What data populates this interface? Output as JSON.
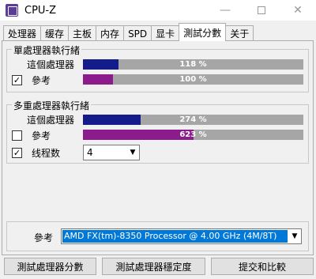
{
  "window": {
    "title": "CPU-Z",
    "minimize_glyph": "—",
    "close_glyph": "✕"
  },
  "tabs": [
    {
      "label": "处理器"
    },
    {
      "label": "缓存"
    },
    {
      "label": "主板"
    },
    {
      "label": "内存"
    },
    {
      "label": "SPD"
    },
    {
      "label": "显卡"
    },
    {
      "label": "測試分數"
    },
    {
      "label": "关于"
    }
  ],
  "single_thread": {
    "title": "單處理器執行緒",
    "this_cpu": {
      "label": "這個處理器",
      "value_text": "118 %",
      "fill_fraction": 0.16,
      "color": "#141c8c"
    },
    "reference": {
      "label": "參考",
      "checked": "✓",
      "value_text": "100 %",
      "fill_fraction": 0.135,
      "color": "#8c1c8c"
    }
  },
  "multi_thread": {
    "title": "多重處理器執行緒",
    "this_cpu": {
      "label": "這個處理器",
      "value_text": "274 %",
      "fill_fraction": 0.26,
      "color": "#141c8c"
    },
    "reference": {
      "label": "參考",
      "checked": "",
      "value_text": "623 %",
      "fill_fraction": 0.5,
      "color": "#8c1c8c"
    },
    "threads": {
      "label": "线程数",
      "checked": "✓",
      "value": "4"
    }
  },
  "reference_select": {
    "label": "參考",
    "value": "AMD FX(tm)-8350 Processor @ 4.00 GHz (4M/8T)"
  },
  "buttons": {
    "bench_cpu": "測試處理器分數",
    "stress_cpu": "測試處理器穩定度",
    "submit": "提交和比較"
  },
  "colors": {
    "bar_background": "#a6a6a6",
    "selection": "#0078d7"
  }
}
